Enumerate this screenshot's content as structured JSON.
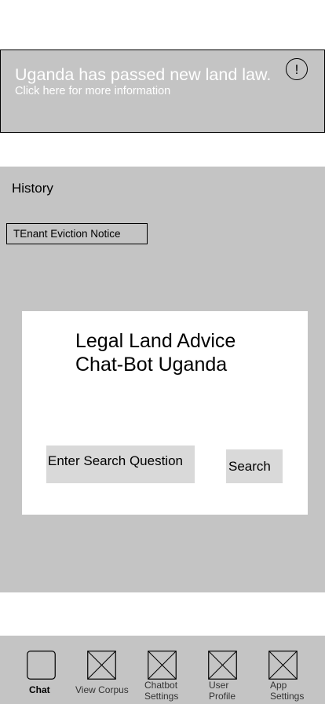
{
  "banner": {
    "title": "Uganda has passed new land law.",
    "subtitle": "Click here for more information",
    "icon_glyph": "!"
  },
  "history": {
    "title": "History",
    "items": [
      {
        "label": "TEnant Eviction Notice"
      }
    ]
  },
  "chat": {
    "title_line1": "Legal Land Advice",
    "title_line2": "Chat-Bot Uganda",
    "search_placeholder": "Enter Search Question",
    "search_button": "Search"
  },
  "nav": {
    "items": [
      {
        "label": "Chat",
        "icon": "chat-icon",
        "active": true
      },
      {
        "label": "View Corpus",
        "icon": "placeholder-image-icon",
        "active": false
      },
      {
        "label_line1": "Chatbot",
        "label_line2": "Settings",
        "icon": "placeholder-image-icon",
        "active": false
      },
      {
        "label_line1": "User",
        "label_line2": "Profile",
        "icon": "placeholder-image-icon",
        "active": false
      },
      {
        "label_line1": "App",
        "label_line2": "Settings",
        "icon": "placeholder-image-icon",
        "active": false
      }
    ]
  },
  "colors": {
    "panel_gray": "#c4c4c4",
    "field_gray": "#d9d9d9",
    "banner_text": "#ffffff"
  }
}
